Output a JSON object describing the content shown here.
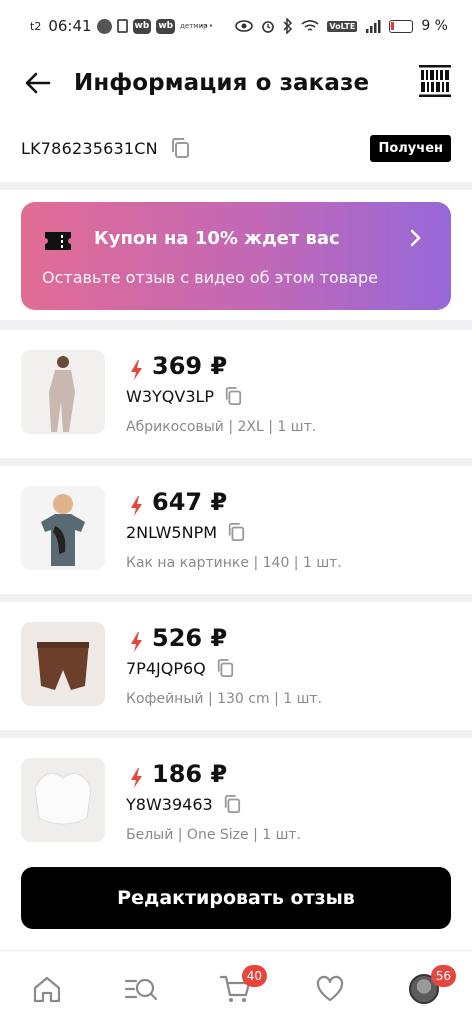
{
  "status_bar": {
    "carrier": "t2",
    "time": "06:41",
    "app_icons": [
      "wb",
      "wb"
    ],
    "mini_label": "детмир",
    "more": "···",
    "volte": "VoLTE",
    "battery": "9 %"
  },
  "header": {
    "title": "Информация о заказе",
    "back_icon": "arrow-left-icon",
    "right_icon": "barcode-icon"
  },
  "order": {
    "number": "LK786235631CN",
    "status": "Получен"
  },
  "coupon": {
    "title": "Купон на 10% ждет вас",
    "subtitle": "Оставьте отзыв с видео об этом товаре",
    "gradient": [
      "#e16c94",
      "#9668d8"
    ]
  },
  "products": [
    {
      "price": "369 ₽",
      "sku": "W3YQV3LP",
      "attrs": "Абрикосовый | 2XL | 1 шт.",
      "image": "dress-photo"
    },
    {
      "price": "647 ₽",
      "sku": "2NLW5NPM",
      "attrs": "Как на картинке | 140 | 1 шт.",
      "image": "kids-tshirt-photo"
    },
    {
      "price": "526 ₽",
      "sku": "7P4JQP6Q",
      "attrs": "Кофейный | 130 cm | 1 шт.",
      "image": "pants-photo"
    },
    {
      "price": "186 ₽",
      "sku": "Y8W39463",
      "attrs": "Белый | One Size | 1 шт.",
      "image": "bra-photo"
    }
  ],
  "edit_button": {
    "label": "Редактировать отзыв"
  },
  "tabbar": {
    "cart_count": "40",
    "profile_count": "56",
    "icons": [
      "home-icon",
      "catalog-search-icon",
      "cart-icon",
      "heart-icon",
      "avatar"
    ]
  },
  "colors": {
    "accent_red": "#e8463d",
    "bolt_red": "#e8463d",
    "badge_black": "#000000"
  }
}
